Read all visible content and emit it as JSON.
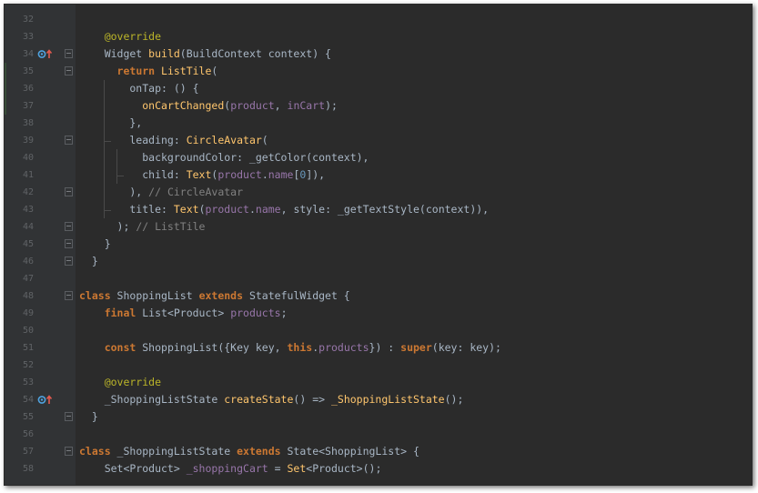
{
  "colors": {
    "background": "#2b2b2b",
    "gutter": "#313335",
    "line_number": "#606366",
    "keyword": "#cc7832",
    "annotation": "#bbb529",
    "function": "#ffc66d",
    "field": "#9876aa",
    "comment": "#808080",
    "number": "#6897bb",
    "default_text": "#a9b7c6"
  },
  "editor": {
    "lines": [
      {
        "n": "32",
        "tokens": []
      },
      {
        "n": "33",
        "tokens": [
          [
            "ann",
            "    @override"
          ]
        ]
      },
      {
        "n": "34",
        "marker": "override-marker-icon",
        "fold": true,
        "tokens": [
          [
            "",
            "    Widget "
          ],
          [
            "fn",
            "build"
          ],
          [
            "",
            "(BuildContext context) {"
          ]
        ]
      },
      {
        "n": "35",
        "fold": true,
        "tokens": [
          [
            "",
            "      "
          ],
          [
            "kw",
            "return "
          ],
          [
            "fn",
            "ListTile"
          ],
          [
            "",
            "("
          ]
        ]
      },
      {
        "n": "36",
        "tokens": [
          [
            "",
            "        onTap: () {"
          ]
        ]
      },
      {
        "n": "37",
        "tokens": [
          [
            "",
            "          "
          ],
          [
            "fn",
            "onCartChanged"
          ],
          [
            "",
            "("
          ],
          [
            "fld",
            "product"
          ],
          [
            "",
            ", "
          ],
          [
            "fld",
            "inCart"
          ],
          [
            "",
            ");"
          ]
        ]
      },
      {
        "n": "38",
        "tokens": [
          [
            "",
            "        },"
          ]
        ]
      },
      {
        "n": "39",
        "fold": true,
        "tokens": [
          [
            "",
            "        leading: "
          ],
          [
            "fn",
            "CircleAvatar"
          ],
          [
            "",
            "("
          ]
        ]
      },
      {
        "n": "40",
        "tokens": [
          [
            "",
            "          backgroundColor: _getColor(context),"
          ]
        ]
      },
      {
        "n": "41",
        "tokens": [
          [
            "",
            "          child: "
          ],
          [
            "fn",
            "Text"
          ],
          [
            "",
            "("
          ],
          [
            "fld",
            "product"
          ],
          [
            "",
            "."
          ],
          [
            "fld",
            "name"
          ],
          [
            "",
            "["
          ],
          [
            "num",
            "0"
          ],
          [
            "",
            "]),"
          ]
        ]
      },
      {
        "n": "42",
        "fold": true,
        "tokens": [
          [
            "",
            "        ), "
          ],
          [
            "cmt",
            "// CircleAvatar"
          ]
        ]
      },
      {
        "n": "43",
        "tokens": [
          [
            "",
            "        title: "
          ],
          [
            "fn",
            "Text"
          ],
          [
            "",
            "("
          ],
          [
            "fld",
            "product"
          ],
          [
            "",
            "."
          ],
          [
            "fld",
            "name"
          ],
          [
            "",
            ", style: _getTextStyle(context)),"
          ]
        ]
      },
      {
        "n": "44",
        "fold": true,
        "tokens": [
          [
            "",
            "      ); "
          ],
          [
            "cmt",
            "// ListTile"
          ]
        ]
      },
      {
        "n": "45",
        "fold": true,
        "tokens": [
          [
            "",
            "    }"
          ]
        ]
      },
      {
        "n": "46",
        "fold": true,
        "tokens": [
          [
            "",
            "  }"
          ]
        ]
      },
      {
        "n": "47",
        "tokens": []
      },
      {
        "n": "48",
        "fold": true,
        "tokens": [
          [
            "kw",
            "class "
          ],
          [
            "",
            "ShoppingList "
          ],
          [
            "kw",
            "extends "
          ],
          [
            "",
            "StatefulWidget {"
          ]
        ]
      },
      {
        "n": "49",
        "tokens": [
          [
            "",
            "    "
          ],
          [
            "kw",
            "final "
          ],
          [
            "",
            "List<Product> "
          ],
          [
            "fld",
            "products"
          ],
          [
            "",
            ";"
          ]
        ]
      },
      {
        "n": "50",
        "tokens": []
      },
      {
        "n": "51",
        "tokens": [
          [
            "",
            "    "
          ],
          [
            "kw",
            "const "
          ],
          [
            "",
            "ShoppingList({Key key, "
          ],
          [
            "kw",
            "this"
          ],
          [
            "",
            "."
          ],
          [
            "fld",
            "products"
          ],
          [
            "",
            "}) : "
          ],
          [
            "kw",
            "super"
          ],
          [
            "",
            "(key: key);"
          ]
        ]
      },
      {
        "n": "52",
        "tokens": []
      },
      {
        "n": "53",
        "tokens": [
          [
            "ann",
            "    @override"
          ]
        ]
      },
      {
        "n": "54",
        "marker": "override-marker-icon",
        "tokens": [
          [
            "",
            "    _ShoppingListState "
          ],
          [
            "fn",
            "createState"
          ],
          [
            "",
            "() => "
          ],
          [
            "fn",
            "_ShoppingListState"
          ],
          [
            "",
            "();"
          ]
        ]
      },
      {
        "n": "55",
        "fold": true,
        "tokens": [
          [
            "",
            "  }"
          ]
        ]
      },
      {
        "n": "56",
        "tokens": []
      },
      {
        "n": "57",
        "fold": true,
        "tokens": [
          [
            "kw",
            "class "
          ],
          [
            "",
            "_ShoppingListState "
          ],
          [
            "kw",
            "extends "
          ],
          [
            "",
            "State<ShoppingList> {"
          ]
        ]
      },
      {
        "n": "58",
        "tokens": [
          [
            "",
            "    Set<Product> "
          ],
          [
            "fld",
            "_shoppingCart"
          ],
          [
            "",
            " = "
          ],
          [
            "fn",
            "Set"
          ],
          [
            "",
            "<Product>();"
          ]
        ]
      }
    ]
  }
}
